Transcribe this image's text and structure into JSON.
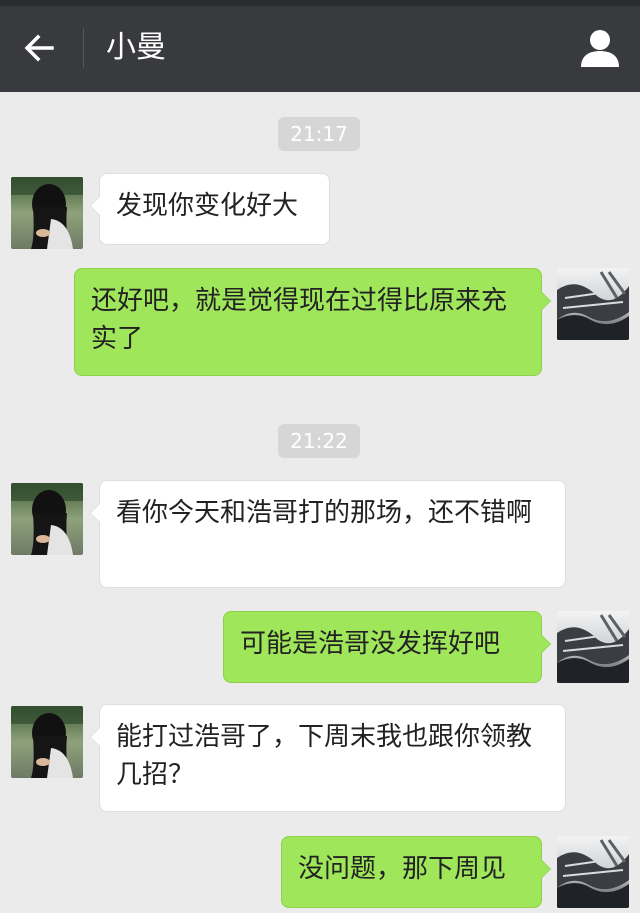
{
  "header": {
    "title": "小曼",
    "back_icon": "arrow-left-icon",
    "profile_icon": "person-icon"
  },
  "colors": {
    "header_bg": "#393a3e",
    "chat_bg": "#ebebeb",
    "outgoing_bubble": "#9fe65a",
    "incoming_bubble": "#ffffff",
    "timestamp_bg": "#d6d6d6"
  },
  "timestamps": [
    "21:17",
    "21:22"
  ],
  "messages": [
    {
      "from": "contact",
      "text": "发现你变化好大"
    },
    {
      "from": "me",
      "text": "还好吧，就是觉得现在过得比原来充实了"
    },
    {
      "from": "contact",
      "text": "看你今天和浩哥打的那场，还不错啊"
    },
    {
      "from": "me",
      "text": "可能是浩哥没发挥好吧"
    },
    {
      "from": "contact",
      "text": "能打过浩哥了，下周末我也跟你领教几招？"
    },
    {
      "from": "me",
      "text": "没问题，那下周见"
    }
  ]
}
